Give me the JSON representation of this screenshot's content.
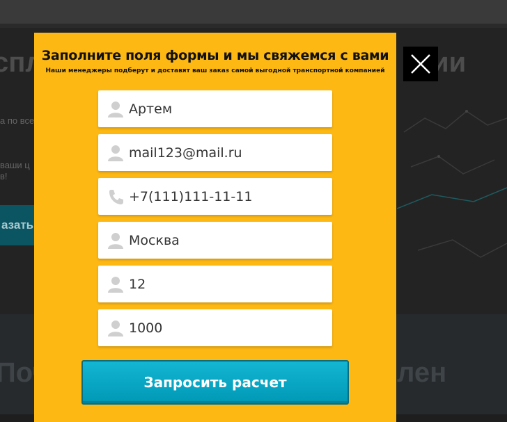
{
  "background": {
    "hero_left": "спл",
    "hero_right": "ии",
    "line1": "а по все",
    "line2": "ваши ц",
    "line3": "в!",
    "button_fragment": "азать",
    "lower_left": "Поч",
    "lower_right": "лен"
  },
  "modal": {
    "title": "Заполните поля формы и мы свяжемся с вами",
    "subtitle": "Наши менеджеры подберут и доставят ваш заказ самой выгодной транспортной компанией",
    "fields": [
      {
        "value": "Артем",
        "icon": "person-icon"
      },
      {
        "value": "mail123@mail.ru",
        "icon": "person-icon"
      },
      {
        "value": "+7(111)111-11-11",
        "icon": "phone-icon"
      },
      {
        "value": "Москва",
        "icon": "person-icon"
      },
      {
        "value": "12",
        "icon": "person-icon"
      },
      {
        "value": "1000",
        "icon": "person-icon"
      }
    ],
    "submit_label": "Запросить расчет"
  },
  "colors": {
    "modal_bg": "#fdb813",
    "button": "#0098b5",
    "close_bg": "#000000"
  }
}
